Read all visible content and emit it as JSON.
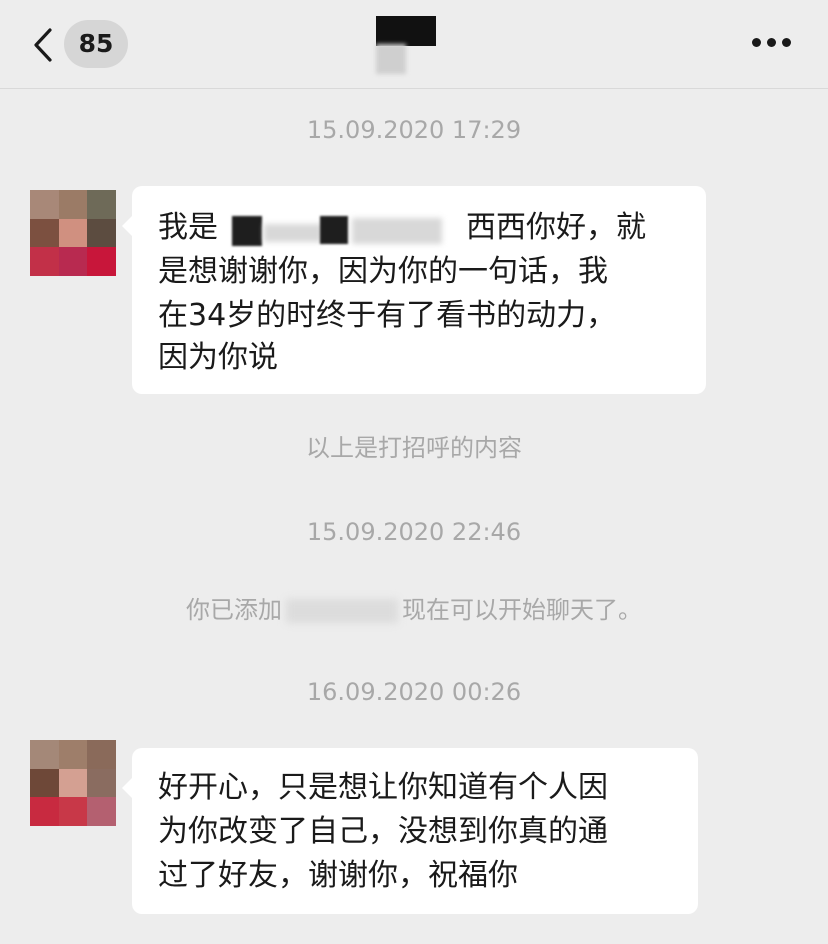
{
  "header": {
    "back_icon": "chevron-left-icon",
    "unread_count": "85",
    "more_icon": "more-horizontal-icon"
  },
  "chat": {
    "timestamps": [
      "15.09.2020 17:29",
      "15.09.2020 22:46",
      "16.09.2020 00:26"
    ],
    "system_messages": {
      "greeting_note": "以上是打招呼的内容",
      "added_prefix": "你已添加",
      "added_suffix": "现在可以开始聊天了。"
    },
    "messages": [
      {
        "line1_prefix": "我是",
        "line1_suffix": "西西你好，就",
        "line2": "是想谢谢你，因为你的一句话，我",
        "line3": "在34岁的时终于有了看书的动力，",
        "line4": "因为你说"
      },
      {
        "line1": "好开心，只是想让你知道有个人因",
        "line2": "为你改变了自己，没想到你真的通",
        "line3": "过了好友，谢谢你，祝福你"
      }
    ]
  },
  "colors": {
    "background": "#ededed",
    "bubble": "#ffffff",
    "timestamp_text": "#a8a8a8",
    "message_text": "#1a1a1a"
  }
}
